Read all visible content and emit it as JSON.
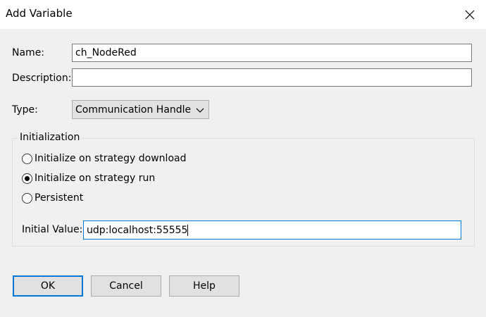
{
  "window": {
    "title": "Add Variable",
    "close_icon": "close-icon"
  },
  "form": {
    "name_label": "Name:",
    "name_value": "ch_NodeRed",
    "description_label": "Description:",
    "description_value": "",
    "type_label": "Type:",
    "type_selected": "Communication Handle"
  },
  "initialization": {
    "legend": "Initialization",
    "options": [
      {
        "label": "Initialize on strategy download",
        "selected": false
      },
      {
        "label": "Initialize on strategy run",
        "selected": true
      },
      {
        "label": "Persistent",
        "selected": false
      }
    ],
    "initial_value_label": "Initial Value:",
    "initial_value": "udp:localhost:55555"
  },
  "buttons": {
    "ok": "OK",
    "cancel": "Cancel",
    "help": "Help"
  },
  "colors": {
    "accent": "#0078d7",
    "background": "#f0f0f0"
  }
}
